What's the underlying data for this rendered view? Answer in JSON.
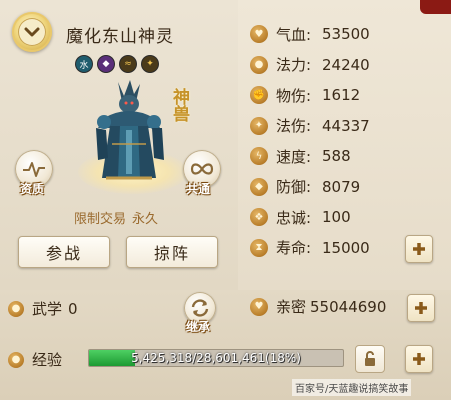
{
  "pet": {
    "name": "魔化东山神灵",
    "badge": "神兽",
    "trade_status": "限制交易",
    "duration": "永久"
  },
  "elements": [
    {
      "name": "water",
      "glyph": "水"
    },
    {
      "name": "purple-orb",
      "glyph": "◆"
    },
    {
      "name": "swirl",
      "glyph": "≈"
    },
    {
      "name": "flame",
      "glyph": "✦"
    }
  ],
  "side_buttons": {
    "aptitude": "资质",
    "common": "共通"
  },
  "actions": {
    "join_battle": "参战",
    "formation": "掠阵"
  },
  "stats": [
    {
      "key": "hp",
      "label": "气血:",
      "value": "53500",
      "icon": "heart-icon",
      "plus": false
    },
    {
      "key": "mp",
      "label": "法力:",
      "value": "24240",
      "icon": "drop-icon",
      "plus": false
    },
    {
      "key": "phys_atk",
      "label": "物伤:",
      "value": "1612",
      "icon": "fist-icon",
      "plus": false
    },
    {
      "key": "mag_atk",
      "label": "法伤:",
      "value": "44337",
      "icon": "flame-icon",
      "plus": false
    },
    {
      "key": "speed",
      "label": "速度:",
      "value": "588",
      "icon": "bolt-icon",
      "plus": false
    },
    {
      "key": "defense",
      "label": "防御:",
      "value": "8079",
      "icon": "shield-icon",
      "plus": false
    },
    {
      "key": "loyalty",
      "label": "忠诚:",
      "value": "100",
      "icon": "loyalty-icon",
      "plus": false
    },
    {
      "key": "lifespan",
      "label": "寿命:",
      "value": "15000",
      "icon": "hourglass-icon",
      "plus": true
    }
  ],
  "martial": {
    "label": "武学",
    "value": "0"
  },
  "inherit": {
    "label": "继承"
  },
  "intimacy": {
    "label": "亲密",
    "value": "55044690"
  },
  "experience": {
    "label": "经验",
    "text": "5,425,318/28,601,461(18%)",
    "percent": 18
  },
  "watermark": "百家号/天蓝趣说搞笑故事",
  "colors": {
    "accent_gold": "#c6932a",
    "xp_green": "#2aa844",
    "text_dark": "#3a2a18",
    "trade_text": "#9a6a2e",
    "corner_red": "#8b1a14"
  }
}
